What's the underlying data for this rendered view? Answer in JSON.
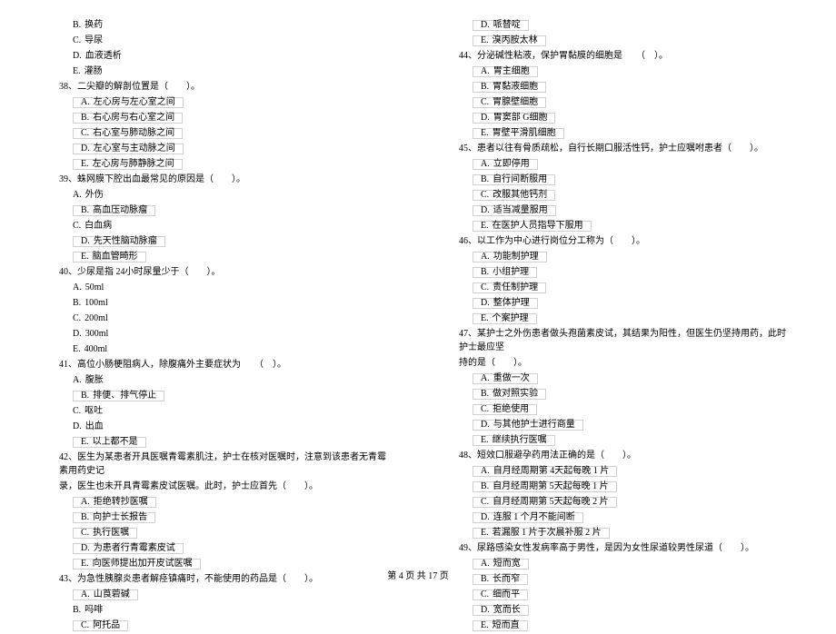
{
  "left": {
    "pre": [
      {
        "l": "B.",
        "t": "换药"
      },
      {
        "l": "C.",
        "t": "导尿"
      },
      {
        "l": "D.",
        "t": "血液透析"
      },
      {
        "l": "E.",
        "t": "灌肠"
      }
    ],
    "q38": {
      "stem": "38、二尖瓣的解剖位置是（　　）。",
      "opts": [
        {
          "l": "A.",
          "t": "左心房与左心室之间"
        },
        {
          "l": "B.",
          "t": "右心房与右心室之间"
        },
        {
          "l": "C.",
          "t": "右心室与肺动脉之间"
        },
        {
          "l": "D.",
          "t": "左心室与主动脉之间"
        },
        {
          "l": "E.",
          "t": "左心房与肺静脉之间"
        }
      ]
    },
    "q39": {
      "stem": "39、蛛网膜下腔出血最常见的原因是（　　）。",
      "opts": [
        {
          "l": "A.",
          "t": "外伤"
        },
        {
          "l": "B.",
          "t": "高血压动脉瘤"
        },
        {
          "l": "C.",
          "t": "白血病"
        },
        {
          "l": "D.",
          "t": "先天性脑动脉瘤"
        },
        {
          "l": "E.",
          "t": "脑血管畸形"
        }
      ]
    },
    "q40": {
      "stem": "40、少尿是指  24小时尿量少于（　　）。",
      "opts": [
        {
          "l": "A.",
          "t": "50ml"
        },
        {
          "l": "B.",
          "t": "100ml"
        },
        {
          "l": "C.",
          "t": "200ml"
        },
        {
          "l": "D.",
          "t": "300ml"
        },
        {
          "l": "E.",
          "t": "400ml"
        }
      ]
    },
    "q41": {
      "stem": "41、高位小肠梗阻病人，除腹痛外主要症状为　　（　）。",
      "opts": [
        {
          "l": "A.",
          "t": "腹胀"
        },
        {
          "l": "B.",
          "t": "排便、排气停止"
        },
        {
          "l": "C.",
          "t": "呕吐"
        },
        {
          "l": "D.",
          "t": "出血"
        },
        {
          "l": "E.",
          "t": "以上都不是"
        }
      ]
    },
    "q42": {
      "stem1": "42、医生为某患者开具医嘱青霉素肌注，护士在核对医嘱时，注意到该患者无青霉素用药史记",
      "stem2": "录，医生也未开具青霉素皮试医嘱。此时，护士应首先（　　）。",
      "opts": [
        {
          "l": "A.",
          "t": "拒绝转抄医嘱"
        },
        {
          "l": "B.",
          "t": "向护士长报告"
        },
        {
          "l": "C.",
          "t": "执行医嘱"
        },
        {
          "l": "D.",
          "t": "为患者行青霉素皮试"
        },
        {
          "l": "E.",
          "t": "向医师提出加开皮试医嘱"
        }
      ]
    },
    "q43": {
      "stem": "43、为急性胰腺炎患者解痉镇痛时，不能使用的药品是（　　）。",
      "opts": [
        {
          "l": "A.",
          "t": "山莨菪碱"
        },
        {
          "l": "B.",
          "t": "吗啡"
        },
        {
          "l": "C.",
          "t": "阿托品"
        }
      ]
    }
  },
  "right": {
    "pre": [
      {
        "l": "D.",
        "t": "哌替啶"
      },
      {
        "l": "E.",
        "t": "溴丙胺太林"
      }
    ],
    "q44": {
      "stem": "44、分泌碱性粘液，保护胃黏膜的细胞是　　（　）。",
      "opts": [
        {
          "l": "A.",
          "t": "胃主细胞"
        },
        {
          "l": "B.",
          "t": "胃黏液细胞"
        },
        {
          "l": "C.",
          "t": "胃腺壁细胞"
        },
        {
          "l": "D.",
          "t": "胃窦部  G细胞"
        },
        {
          "l": "E.",
          "t": "胃壁平滑肌细胞"
        }
      ]
    },
    "q45": {
      "stem": "45、患者以往有骨质疏松，自行长期口服活性钙，护士应嘱咐患者（　　）。",
      "opts": [
        {
          "l": "A.",
          "t": "立即停用"
        },
        {
          "l": "B.",
          "t": "自行间断服用"
        },
        {
          "l": "C.",
          "t": "改服其他钙剂"
        },
        {
          "l": "D.",
          "t": "适当减量服用"
        },
        {
          "l": "E.",
          "t": "在医护人员指导下服用"
        }
      ]
    },
    "q46": {
      "stem": "46、以工作为中心进行岗位分工称为（　　）。",
      "opts": [
        {
          "l": "A.",
          "t": "功能制护理"
        },
        {
          "l": "B.",
          "t": "小组护理"
        },
        {
          "l": "C.",
          "t": "责任制护理"
        },
        {
          "l": "D.",
          "t": "整体护理"
        },
        {
          "l": "E.",
          "t": "个案护理"
        }
      ]
    },
    "q47": {
      "stem1": "47、某护士之外伤患者做头孢菌素皮试，其结果为阳性，但医生仍坚持用药，此时护士最应坚",
      "stem2": "持的是（　　）。",
      "opts": [
        {
          "l": "A.",
          "t": "重做一次"
        },
        {
          "l": "B.",
          "t": "做对照实验"
        },
        {
          "l": "C.",
          "t": "拒绝使用"
        },
        {
          "l": "D.",
          "t": "与其他护士进行商量"
        },
        {
          "l": "E.",
          "t": "继续执行医嘱"
        }
      ]
    },
    "q48": {
      "stem": "48、短效口服避孕药用法正确的是（　　）。",
      "opts": [
        {
          "l": "A.",
          "t": "自月经周期第  4天起每晚 1 片"
        },
        {
          "l": "B.",
          "t": "自月经周期第  5天起每晚 1 片"
        },
        {
          "l": "C.",
          "t": "自月经周期第  5天起每晚 2 片"
        },
        {
          "l": "D.",
          "t": "连服 1 个月不能间断"
        },
        {
          "l": "E.",
          "t": "若漏服 1 片于次晨补服  2 片"
        }
      ]
    },
    "q49": {
      "stem": "49、尿路感染女性发病率高于男性，是因为女性尿道较男性尿道（　　）。",
      "opts": [
        {
          "l": "A.",
          "t": "短而宽"
        },
        {
          "l": "B.",
          "t": "长而窄"
        },
        {
          "l": "C.",
          "t": "细而平"
        },
        {
          "l": "D.",
          "t": "宽而长"
        },
        {
          "l": "E.",
          "t": "短而直"
        }
      ]
    }
  },
  "footer": "第  4 页  共  17 页"
}
